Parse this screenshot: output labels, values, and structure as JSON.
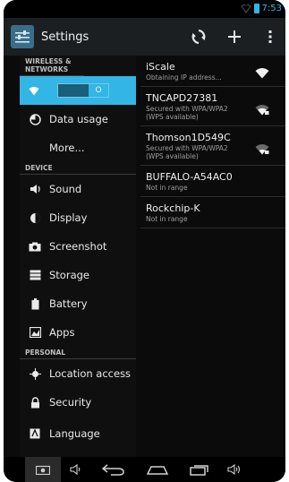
{
  "status": {
    "time": "7:53"
  },
  "actionbar": {
    "title": "Settings"
  },
  "left": {
    "sections": {
      "wireless": "WIRELESS & NETWORKS",
      "device": "DEVICE",
      "personal": "PERSONAL"
    },
    "wifi_toggle": "O",
    "items": {
      "data_usage": "Data usage",
      "more": "More...",
      "sound": "Sound",
      "display": "Display",
      "screenshot": "Screenshot",
      "storage": "Storage",
      "battery": "Battery",
      "apps": "Apps",
      "location": "Location access",
      "security": "Security",
      "language": "Language"
    }
  },
  "networks": [
    {
      "name": "iScale",
      "status": "Obtaining IP address..."
    },
    {
      "name": "TNCAPD27381",
      "status": "Secured with WPA/WPA2 (WPS available)"
    },
    {
      "name": "Thomson1D549C",
      "status": "Secured with WPA/WPA2 (WPS available)"
    },
    {
      "name": "BUFFALO-A54AC0",
      "status": "Not in range"
    },
    {
      "name": "Rockchip-K",
      "status": "Not in range"
    }
  ],
  "colors": {
    "accent": "#33b5e5",
    "background": "#0b0b0b"
  }
}
